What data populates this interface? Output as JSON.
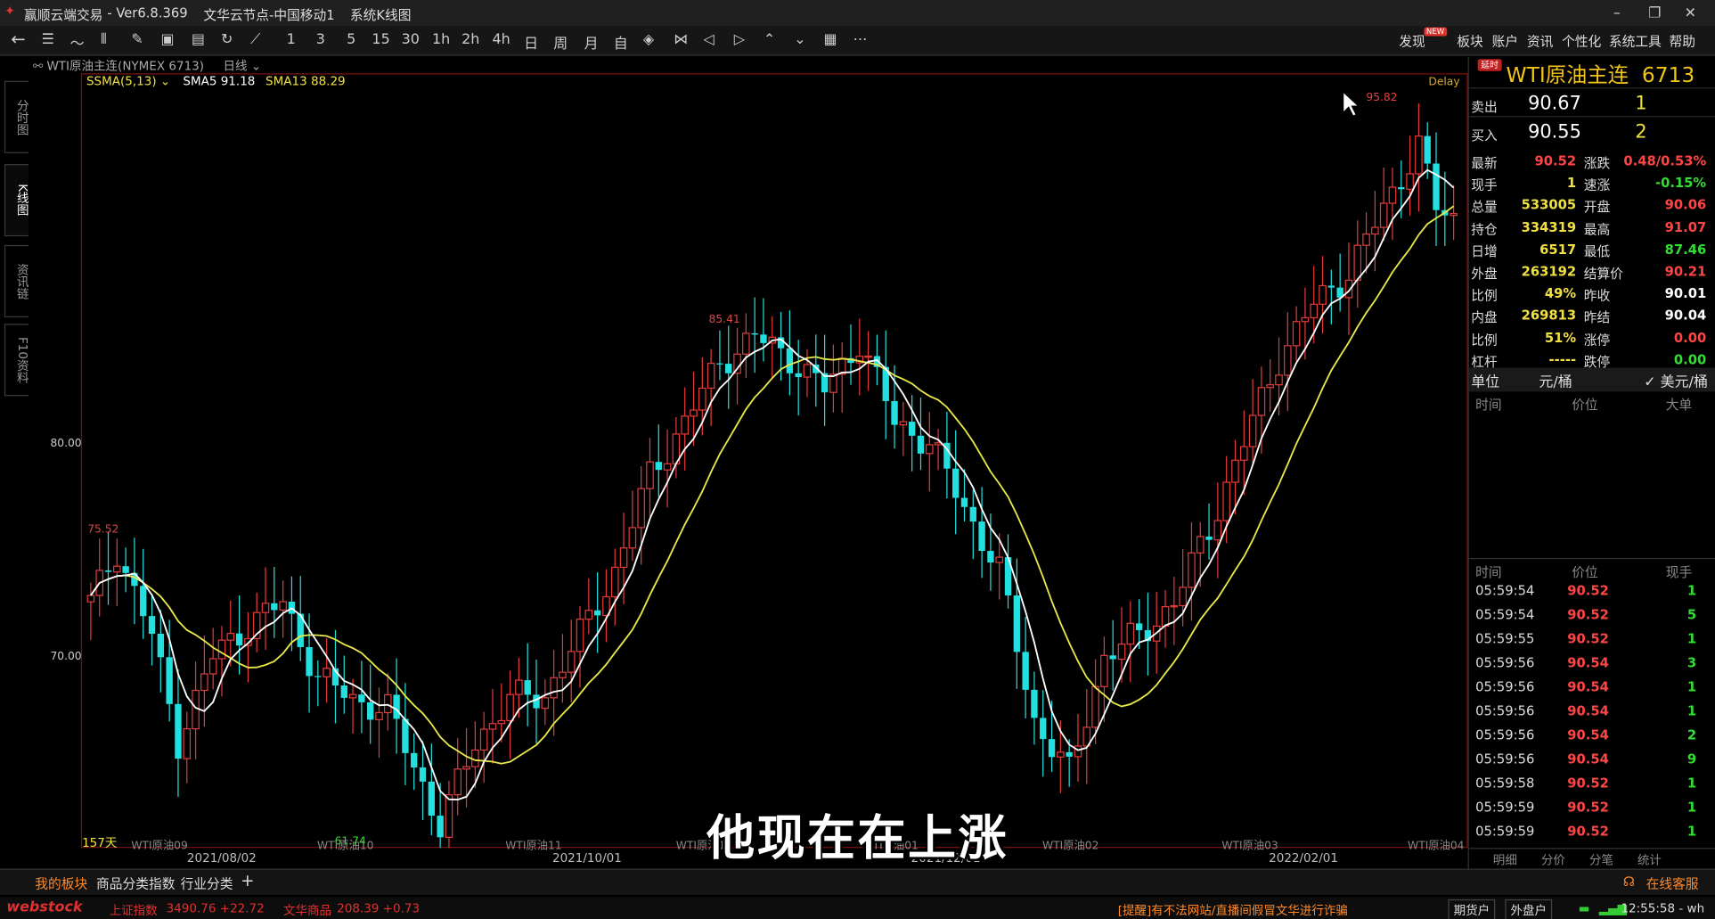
{
  "titlebar": {
    "app": "赢顺云端交易",
    "version": "- Ver6.8.369",
    "node": "文华云节点-中国移动1",
    "window": "系统K线图"
  },
  "toolbar": {
    "periods": [
      "1",
      "3",
      "5",
      "15",
      "30",
      "1h",
      "2h",
      "4h",
      "日",
      "周",
      "月",
      "自"
    ],
    "right_menu": [
      "发现",
      "板块",
      "账户",
      "资讯",
      "个性化",
      "系统工具",
      "帮助"
    ],
    "new_badge": "NEW"
  },
  "side_tabs": [
    "分时图",
    "K线图",
    "资讯链",
    "F10资料"
  ],
  "chart_header": {
    "symbol": "WTI原油主连(NYMEX 6713)",
    "period": "日线",
    "delay": "Delay"
  },
  "legend": {
    "indicator": "SSMA(5,13)",
    "sma5": "SMA5 91.18",
    "sma13": "SMA13 88.29"
  },
  "chart_data": {
    "type": "candlestick",
    "ylabels": [
      "80.00",
      "70.00"
    ],
    "xlabels": [
      "2021/08/02",
      "2021/10/01",
      "2021/12/01",
      "2022/02/01"
    ],
    "contracts": [
      "WTI原油09",
      "WTI原油10",
      "WTI原油11",
      "WTI原油12",
      "WTI原油01",
      "WTI原油02",
      "WTI原油03",
      "WTI原油04"
    ],
    "bars_label": "157天",
    "price_labels": [
      "75.52",
      "85.41",
      "95.82",
      "61.74"
    ],
    "colors": {
      "up": "#e33b3b",
      "down": "#22e0e0",
      "sma5": "#ffffff",
      "sma13": "#e8e84a"
    }
  },
  "subtitle": "他现在在上涨",
  "quote": {
    "delay_badge": "延时",
    "name": "WTI原油主连",
    "code": "6713",
    "sell": {
      "label": "卖出",
      "price": "90.67",
      "qty": "1"
    },
    "buy": {
      "label": "买入",
      "price": "90.55",
      "qty": "2"
    },
    "rows": [
      {
        "l1": "最新",
        "v1": "90.52",
        "c1": "#ff4444",
        "l2": "涨跌",
        "v2": "0.48/0.53%",
        "c2": "#ff4444"
      },
      {
        "l1": "现手",
        "v1": "1",
        "c1": "#f0e040",
        "l2": "速涨",
        "v2": "-0.15%",
        "c2": "#33dd33"
      },
      {
        "l1": "总量",
        "v1": "533005",
        "c1": "#f0e040",
        "l2": "开盘",
        "v2": "90.06",
        "c2": "#ff4444"
      },
      {
        "l1": "持仓",
        "v1": "334319",
        "c1": "#f0e040",
        "l2": "最高",
        "v2": "91.07",
        "c2": "#ff4444"
      },
      {
        "l1": "日增",
        "v1": "6517",
        "c1": "#f0e040",
        "l2": "最低",
        "v2": "87.46",
        "c2": "#33dd33"
      },
      {
        "l1": "外盘",
        "v1": "263192",
        "c1": "#f0e040",
        "l2": "结算价",
        "v2": "90.21",
        "c2": "#ff4444"
      },
      {
        "l1": "比例",
        "v1": "49%",
        "c1": "#f0e040",
        "l2": "昨收",
        "v2": "90.01",
        "c2": "#ffffff"
      },
      {
        "l1": "内盘",
        "v1": "269813",
        "c1": "#f0e040",
        "l2": "昨结",
        "v2": "90.04",
        "c2": "#ffffff"
      },
      {
        "l1": "比例",
        "v1": "51%",
        "c1": "#f0e040",
        "l2": "涨停",
        "v2": "0.00",
        "c2": "#ff4444"
      },
      {
        "l1": "杠杆",
        "v1": "-----",
        "c1": "#f0e040",
        "l2": "跌停",
        "v2": "0.00",
        "c2": "#33dd33"
      }
    ],
    "unit_label": "单位",
    "unit_a": "元/桶",
    "unit_b": "✓ 美元/桶",
    "big_headers": [
      "时间",
      "价位",
      "大单"
    ],
    "tick_headers": [
      "时间",
      "价位",
      "现手"
    ],
    "ticks": [
      {
        "t": "05:59:54",
        "p": "90.52",
        "q": "1"
      },
      {
        "t": "05:59:54",
        "p": "90.52",
        "q": "5"
      },
      {
        "t": "05:59:55",
        "p": "90.52",
        "q": "1"
      },
      {
        "t": "05:59:56",
        "p": "90.54",
        "q": "3"
      },
      {
        "t": "05:59:56",
        "p": "90.54",
        "q": "1"
      },
      {
        "t": "05:59:56",
        "p": "90.54",
        "q": "1"
      },
      {
        "t": "05:59:56",
        "p": "90.54",
        "q": "2"
      },
      {
        "t": "05:59:56",
        "p": "90.54",
        "q": "9"
      },
      {
        "t": "05:59:58",
        "p": "90.52",
        "q": "1"
      },
      {
        "t": "05:59:59",
        "p": "90.52",
        "q": "1"
      },
      {
        "t": "05:59:59",
        "p": "90.52",
        "q": "1"
      }
    ],
    "bottom_tabs": [
      "明细",
      "分价",
      "分笔",
      "统计"
    ]
  },
  "bottom_tabs": {
    "my": "我的板块",
    "idx": "商品分类指数",
    "ind": "行业分类",
    "add": "+",
    "service": "在线客服"
  },
  "status": {
    "logo": "webstock",
    "sh_label": "上证指数",
    "sh_val": "3490.76 +22.72",
    "wh_label": "文华商品",
    "wh_val": "208.39 +0.73",
    "notice": "[提醒]有不法网站/直播间假冒文华进行诈骗",
    "acct1": "期货户",
    "acct2": "外盘户",
    "time": "12:55:58 - wh"
  }
}
